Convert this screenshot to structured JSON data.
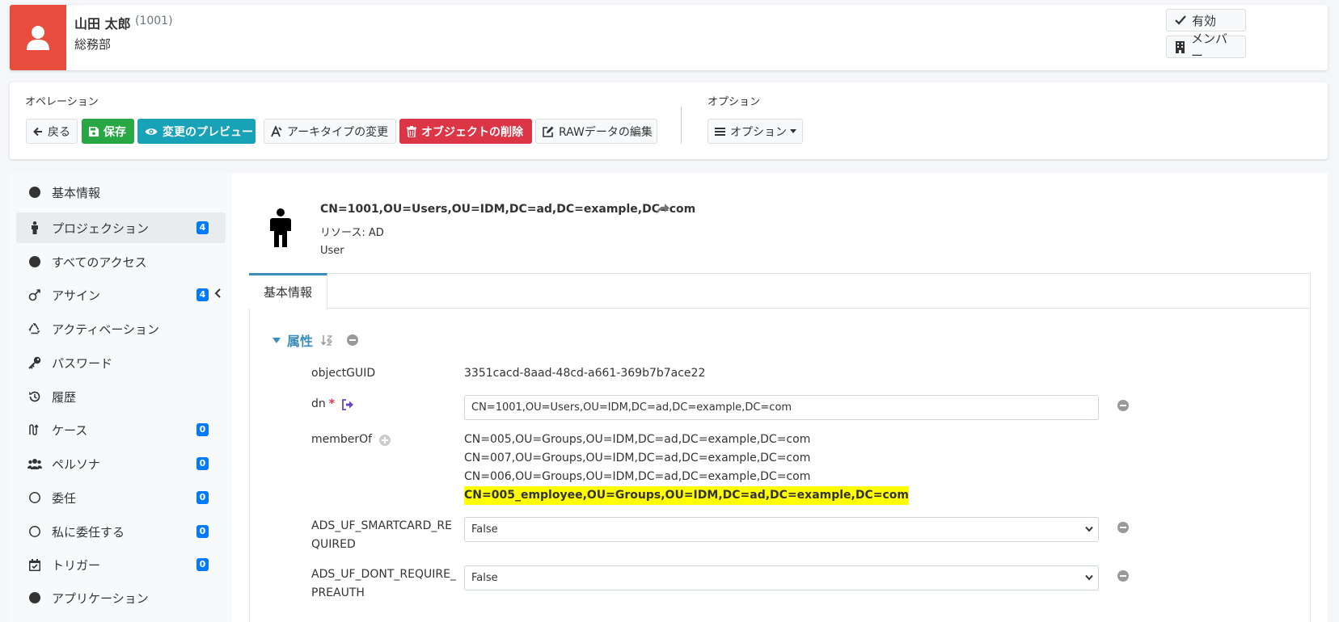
{
  "header": {
    "user_name": "山田 太郎",
    "user_id": "(1001)",
    "department": "総務部",
    "enabled_label": "有効",
    "member_label": "メンバー"
  },
  "operations": {
    "label": "オペレーション",
    "back": "戻る",
    "save": "保存",
    "preview": "変更のプレビュー",
    "archetype": "アーキタイプの変更",
    "delete": "オブジェクトの削除",
    "raw": "RAWデータの編集"
  },
  "options": {
    "label": "オプション",
    "button": "オプション"
  },
  "sidebar": {
    "items": [
      {
        "label": "基本情報"
      },
      {
        "label": "プロジェクション",
        "badge": "4"
      },
      {
        "label": "すべてのアクセス"
      },
      {
        "label": "アサイン",
        "badge": "4"
      },
      {
        "label": "アクティベーション"
      },
      {
        "label": "パスワード"
      },
      {
        "label": "履歴"
      },
      {
        "label": "ケース",
        "badge": "0"
      },
      {
        "label": "ペルソナ",
        "badge": "0"
      },
      {
        "label": "委任",
        "badge": "0"
      },
      {
        "label": "私に委任する",
        "badge": "0"
      },
      {
        "label": "トリガー",
        "badge": "0"
      },
      {
        "label": "アプリケーション"
      }
    ]
  },
  "projection": {
    "dn": "CN=1001,OU=Users,OU=IDM,DC=ad,DC=example,DC=com",
    "resource": "リソース: AD",
    "kind": "User"
  },
  "tab": {
    "label": "基本情報"
  },
  "attributes": {
    "section_title": "属性",
    "objectGUID": {
      "label": "objectGUID",
      "value": "3351cacd-8aad-48cd-a661-369b7b7ace22"
    },
    "dn": {
      "label": "dn",
      "required_mark": "*",
      "value": "CN=1001,OU=Users,OU=IDM,DC=ad,DC=example,DC=com"
    },
    "memberOf": {
      "label": "memberOf",
      "values": [
        "CN=005,OU=Groups,OU=IDM,DC=ad,DC=example,DC=com",
        "CN=007,OU=Groups,OU=IDM,DC=ad,DC=example,DC=com",
        "CN=006,OU=Groups,OU=IDM,DC=ad,DC=example,DC=com",
        "CN=005_employee,OU=Groups,OU=IDM,DC=ad,DC=example,DC=com"
      ]
    },
    "smartcard": {
      "label_line1": "ADS_UF_SMARTCARD_RE",
      "label_line2": "QUIRED",
      "value": "False"
    },
    "preauth": {
      "label_line1": "ADS_UF_DONT_REQUIRE_",
      "label_line2": "PREAUTH",
      "value": "False"
    }
  },
  "colors": {
    "avatar": "#e74c3c",
    "success": "#28a745",
    "info": "#17a2b8",
    "danger": "#dc3545",
    "badge": "#007bff",
    "accent": "#3c8dbc",
    "highlight": "#ffff00"
  },
  "icons": {
    "avatar": "user-icon",
    "enabled": "check-icon",
    "member": "building-icon",
    "back": "arrow-left-icon",
    "save": "save-icon",
    "preview": "eye-icon",
    "archetype": "archetype-icon",
    "delete": "trash-icon",
    "raw": "edit-icon",
    "options": "bars-icon",
    "projection": "person-icon",
    "share": "share-icon"
  }
}
